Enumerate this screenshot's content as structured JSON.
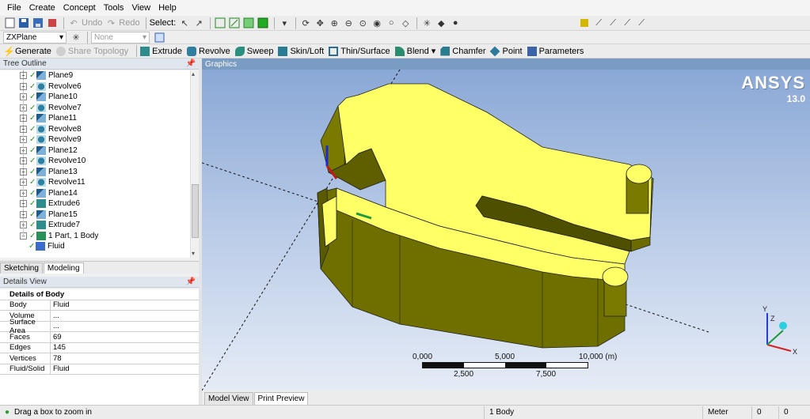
{
  "menu": [
    "File",
    "Create",
    "Concept",
    "Tools",
    "View",
    "Help"
  ],
  "toolbar1": {
    "undo_label": "Undo",
    "redo_label": "Redo",
    "select_label": "Select:"
  },
  "toolbar2": {
    "plane_value": "ZXPlane",
    "sketch_value": "None"
  },
  "toolbar3": {
    "generate": "Generate",
    "share_topology": "Share Topology",
    "extrude": "Extrude",
    "revolve": "Revolve",
    "sweep": "Sweep",
    "skin_loft": "Skin/Loft",
    "thin_surface": "Thin/Surface",
    "blend": "Blend",
    "chamfer": "Chamfer",
    "point": "Point",
    "parameters": "Parameters"
  },
  "tree_outline": {
    "title": "Tree Outline",
    "items": [
      {
        "label": "Plane9",
        "icon": "plane-icon"
      },
      {
        "label": "Revolve6",
        "icon": "revolve-icon"
      },
      {
        "label": "Plane10",
        "icon": "plane-icon"
      },
      {
        "label": "Revolve7",
        "icon": "revolve-icon"
      },
      {
        "label": "Plane11",
        "icon": "plane-icon"
      },
      {
        "label": "Revolve8",
        "icon": "revolve-icon"
      },
      {
        "label": "Revolve9",
        "icon": "revolve-icon"
      },
      {
        "label": "Plane12",
        "icon": "plane-icon"
      },
      {
        "label": "Revolve10",
        "icon": "revolve-icon"
      },
      {
        "label": "Plane13",
        "icon": "plane-icon"
      },
      {
        "label": "Revolve11",
        "icon": "revolve-icon"
      },
      {
        "label": "Plane14",
        "icon": "plane-icon"
      },
      {
        "label": "Extrude6",
        "icon": "extrude-icon"
      },
      {
        "label": "Plane15",
        "icon": "plane-icon"
      },
      {
        "label": "Extrude7",
        "icon": "extrude-icon"
      },
      {
        "label": "1 Part, 1 Body",
        "icon": "part-icon"
      },
      {
        "label": "Fluid",
        "icon": "body-icon"
      }
    ]
  },
  "left_tabs": [
    "Sketching",
    "Modeling"
  ],
  "details_view": {
    "title": "Details View",
    "header": "Details of Body",
    "rows": [
      {
        "key": "Body",
        "value": "Fluid"
      },
      {
        "key": "Volume",
        "value": "..."
      },
      {
        "key": "Surface Area",
        "value": "..."
      },
      {
        "key": "Faces",
        "value": "69"
      },
      {
        "key": "Edges",
        "value": "145"
      },
      {
        "key": "Vertices",
        "value": "78"
      },
      {
        "key": "Fluid/Solid",
        "value": "Fluid"
      }
    ]
  },
  "graphics": {
    "title": "Graphics",
    "logo": "ANSYS",
    "version": "13.0",
    "scale_top": [
      "0,000",
      "5,000",
      "10,000 (m)"
    ],
    "scale_bottom": [
      "2,500",
      "7,500"
    ],
    "model_color": "#ffff66"
  },
  "graphics_tabs": [
    "Model View",
    "Print Preview"
  ],
  "status": {
    "message": "Drag a box to zoom in",
    "selection": "1 Body",
    "units": "Meter",
    "val1": "0",
    "val2": "0"
  }
}
